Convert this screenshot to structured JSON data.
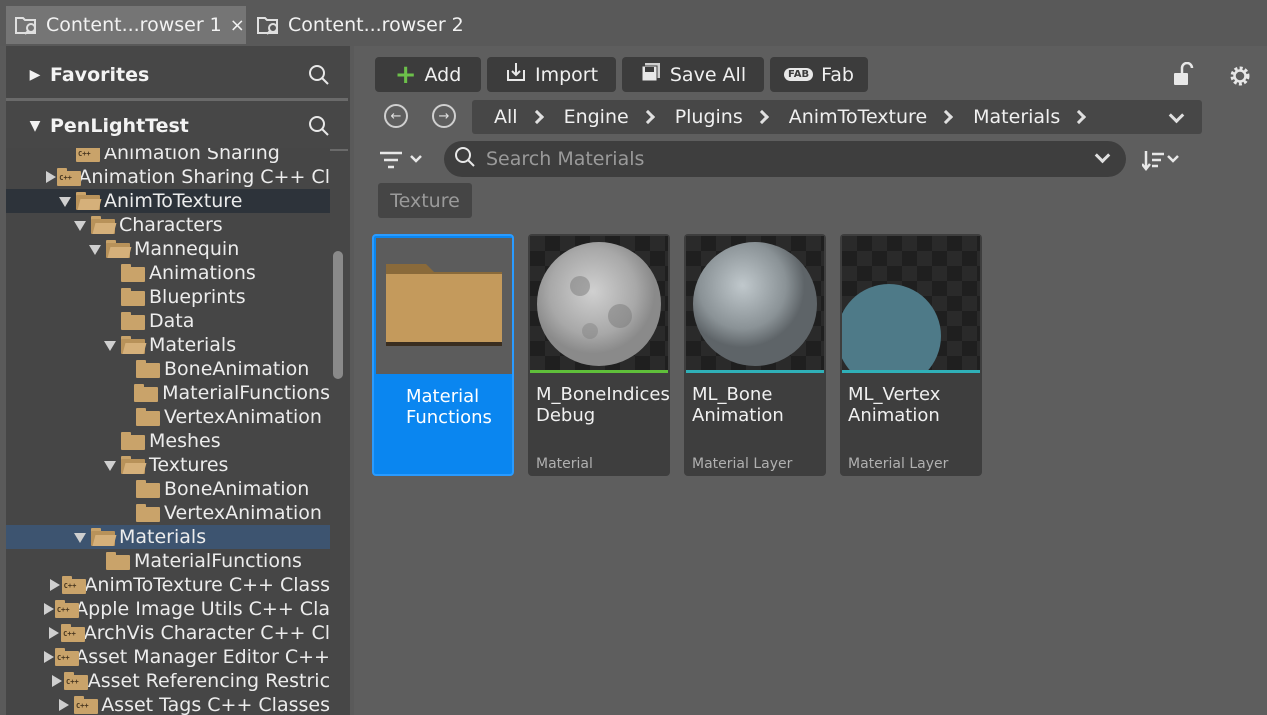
{
  "tabs": [
    {
      "label": "Content...rowser 1",
      "active": true,
      "close": "×"
    },
    {
      "label": "Content...rowser 2",
      "active": false
    }
  ],
  "left_panel": {
    "favorites_label": "Favorites",
    "project_label": "PenLightTest",
    "tree": [
      {
        "label": "Animation Sharing",
        "indent": 0,
        "expander": "none",
        "icon": "cpp-folder"
      },
      {
        "label": "Animation Sharing C++ Cl",
        "indent": 0,
        "expander": "right",
        "icon": "cpp-folder"
      },
      {
        "label": "AnimToTexture",
        "indent": 0,
        "expander": "down",
        "icon": "plugin-folder-open",
        "state": "selected-dark"
      },
      {
        "label": "Characters",
        "indent": 1,
        "expander": "down",
        "icon": "folder-open"
      },
      {
        "label": "Mannequin",
        "indent": 2,
        "expander": "down",
        "icon": "folder-open"
      },
      {
        "label": "Animations",
        "indent": 3,
        "expander": "none",
        "icon": "folder"
      },
      {
        "label": "Blueprints",
        "indent": 3,
        "expander": "none",
        "icon": "folder"
      },
      {
        "label": "Data",
        "indent": 3,
        "expander": "none",
        "icon": "folder"
      },
      {
        "label": "Materials",
        "indent": 3,
        "expander": "down",
        "icon": "folder-open"
      },
      {
        "label": "BoneAnimation",
        "indent": 4,
        "expander": "none",
        "icon": "folder"
      },
      {
        "label": "MaterialFunctions",
        "indent": 4,
        "expander": "none",
        "icon": "folder"
      },
      {
        "label": "VertexAnimation",
        "indent": 4,
        "expander": "none",
        "icon": "folder"
      },
      {
        "label": "Meshes",
        "indent": 3,
        "expander": "none",
        "icon": "folder"
      },
      {
        "label": "Textures",
        "indent": 3,
        "expander": "down",
        "icon": "folder-open"
      },
      {
        "label": "BoneAnimation",
        "indent": 4,
        "expander": "none",
        "icon": "folder"
      },
      {
        "label": "VertexAnimation",
        "indent": 4,
        "expander": "none",
        "icon": "folder"
      },
      {
        "label": "Materials",
        "indent": 1,
        "expander": "down",
        "icon": "folder-open",
        "state": "selected-blue"
      },
      {
        "label": "MaterialFunctions",
        "indent": 2,
        "expander": "none",
        "icon": "folder"
      },
      {
        "label": "AnimToTexture C++ Class",
        "indent": 0,
        "expander": "right",
        "icon": "cpp-folder"
      },
      {
        "label": "Apple Image Utils C++ Cla",
        "indent": 0,
        "expander": "right",
        "icon": "cpp-folder"
      },
      {
        "label": "ArchVis Character C++ Cl",
        "indent": 0,
        "expander": "right",
        "icon": "cpp-folder"
      },
      {
        "label": "Asset Manager Editor C++",
        "indent": 0,
        "expander": "right",
        "icon": "cpp-folder"
      },
      {
        "label": "Asset Referencing Restric",
        "indent": 0,
        "expander": "right",
        "icon": "cpp-folder"
      },
      {
        "label": "Asset Tags C++ Classes",
        "indent": 0,
        "expander": "right",
        "icon": "cpp-folder"
      }
    ]
  },
  "toolbar": {
    "add_label": "Add",
    "import_label": "Import",
    "save_all_label": "Save All",
    "fab_label": "Fab"
  },
  "breadcrumb": [
    "All",
    "Engine",
    "Plugins",
    "AnimToTexture",
    "Materials"
  ],
  "search": {
    "placeholder": "Search Materials"
  },
  "filter_chip": "Texture",
  "assets": [
    {
      "name": "Material Functions",
      "type": "",
      "kind": "folder",
      "selected": true
    },
    {
      "name": "M_BoneIndices Debug",
      "type": "Material",
      "kind": "material",
      "type_color": "#5fbf3a"
    },
    {
      "name": "ML_Bone Animation",
      "type": "Material Layer",
      "kind": "material-layer",
      "type_color": "#2fb0b8"
    },
    {
      "name": "ML_Vertex Animation",
      "type": "Material Layer",
      "kind": "material-layer",
      "type_color": "#2fb0b8"
    }
  ],
  "colors": {
    "selection_blue": "#0a86f0",
    "folder": "#c9a36a"
  }
}
